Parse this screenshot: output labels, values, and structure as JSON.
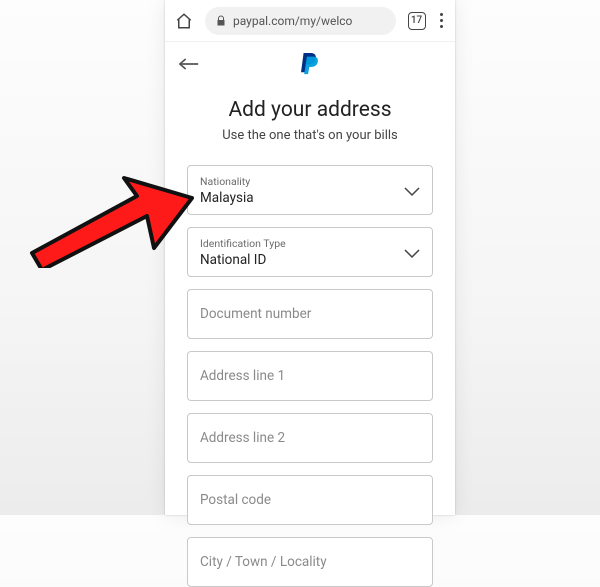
{
  "browser": {
    "url": "paypal.com/my/welco",
    "tab_count": "17"
  },
  "header": {
    "back_icon": "arrow-left",
    "logo_name": "paypal-logo"
  },
  "page": {
    "title": "Add your address",
    "subtitle": "Use the one that's on your bills"
  },
  "fields": {
    "nationality": {
      "label": "Nationality",
      "value": "Malaysia"
    },
    "id_type": {
      "label": "Identification Type",
      "value": "National ID"
    },
    "doc_number": {
      "placeholder": "Document number"
    },
    "address1": {
      "placeholder": "Address line 1"
    },
    "address2": {
      "placeholder": "Address line 2"
    },
    "postal": {
      "placeholder": "Postal code"
    },
    "city": {
      "placeholder": "City / Town / Locality"
    }
  },
  "annotation": {
    "description": "Red arrow pointing at Nationality dropdown"
  }
}
